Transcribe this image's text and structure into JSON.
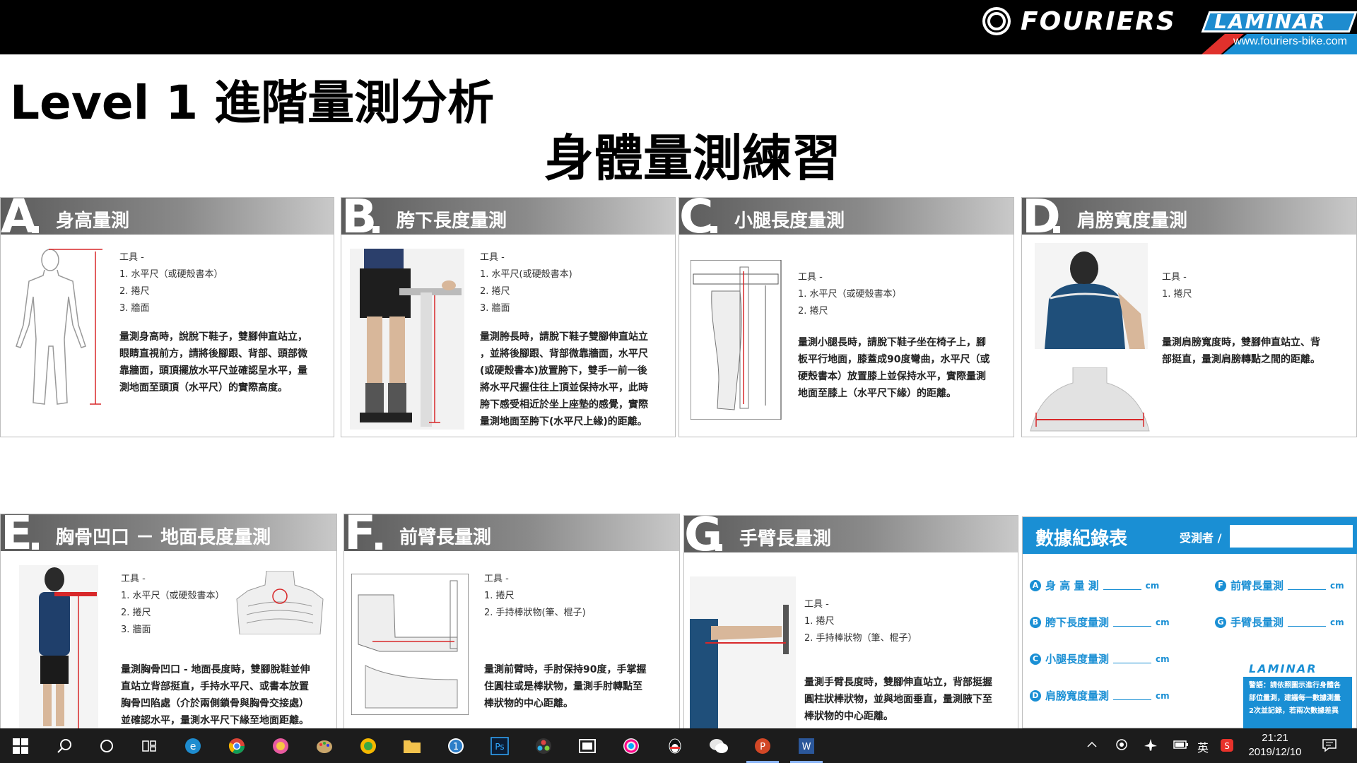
{
  "header": {
    "brand": "FOURIERS",
    "brand2": "LAMINAR",
    "website": "www.fouriers-bike.com"
  },
  "titles": {
    "level": "Level 1 進階量測分析",
    "main": "身體量測練習"
  },
  "cards": {
    "a": {
      "letter": "A",
      "title": "身高量測",
      "tools": [
        "工具 -",
        "1. 水平尺（或硬殼書本）",
        "2. 捲尺",
        "3. 牆面"
      ],
      "desc": [
        "量測身高時，說脫下鞋子，雙腳伸直站立，",
        "眼睛直視前方，請將後腳跟、背部、頭部微",
        "靠牆面，頭頂擺放水平尺並確認呈水平，量",
        "測地面至頭頂（水平尺）的實際高度。"
      ]
    },
    "b": {
      "letter": "B",
      "title": "胯下長度量測",
      "tools": [
        "工具 -",
        "1. 水平尺(或硬殼書本)",
        "2. 捲尺",
        "3. 牆面"
      ],
      "desc": [
        "量測胯長時，請脫下鞋子雙腳伸直站立",
        "，並將後腳跟、背部微靠牆面，水平尺",
        "(或硬殼書本)放置胯下，雙手一前一後",
        "將水平尺握住往上頂並保持水平，此時",
        "胯下感受相近於坐上座墊的感覺，實際",
        "量測地面至胯下(水平尺上緣)的距離。"
      ]
    },
    "c": {
      "letter": "C",
      "title": "小腿長度量測",
      "tools": [
        "工具 -",
        "1. 水平尺（或硬殼書本）",
        "2. 捲尺"
      ],
      "desc": [
        "量測小腿長時，請脫下鞋子坐在椅子上，腳",
        "板平行地面，膝蓋成90度彎曲，水平尺（或",
        "硬殼書本）放置膝上並保持水平，實際量測",
        "地面至膝上（水平尺下緣）的距離。"
      ]
    },
    "d": {
      "letter": "D",
      "title": "肩膀寬度量測",
      "tools": [
        "工具 -",
        "1. 捲尺"
      ],
      "desc": [
        "量測肩膀寬度時，雙腳伸直站立、背",
        "部挺直，量測肩膀轉點之間的距離。"
      ]
    },
    "e": {
      "letter": "E",
      "title": "胸骨凹口 － 地面長度量測",
      "tools": [
        "工具 -",
        "1. 水平尺（或硬殼書本）",
        "2. 捲尺",
        "3. 牆面"
      ],
      "desc": [
        "量測胸骨凹口 - 地面長度時，雙腳脫鞋並伸",
        "直站立背部挺直，手持水平尺、或書本放置",
        "胸骨凹陷處（介於兩側鎖骨與胸骨交接處）",
        "並確認水平，量測水平尺下緣至地面距離。"
      ]
    },
    "f": {
      "letter": "F",
      "title": "前臂長量測",
      "tools": [
        "工具 -",
        "1. 捲尺",
        "2. 手持棒狀物(筆、棍子)"
      ],
      "desc": [
        "量測前臂時，手肘保持90度，手掌握",
        "住圓柱或是棒狀物，量測手肘轉點至",
        "棒狀物的中心距離。"
      ]
    },
    "g": {
      "letter": "G",
      "title": "手臂長量測",
      "tools": [
        "工具 -",
        "1. 捲尺",
        "2. 手持棒狀物（筆、棍子）"
      ],
      "desc": [
        "量測手臂長度時，雙腳伸直站立，背部挺握",
        "圓柱狀棒狀物，並與地面垂直，量測腋下至",
        "棒狀物的中心距離。"
      ]
    }
  },
  "data_table": {
    "title": "數據紀錄表",
    "tester_label": "受測者 /",
    "unit": "cm",
    "rows_left": [
      {
        "badge": "A",
        "label": "身 高 量 測"
      },
      {
        "badge": "B",
        "label": "胯下長度量測"
      },
      {
        "badge": "C",
        "label": "小腿長度量測"
      },
      {
        "badge": "D",
        "label": "肩膀寬度量測"
      }
    ],
    "rows_right": [
      {
        "badge": "F",
        "label": "前臂長量測"
      },
      {
        "badge": "G",
        "label": "手臂長量測"
      }
    ],
    "brand": "LAMINAR",
    "warning": [
      "警語：請依照圖示進行身體各",
      "部位量測，建議每一數據測量",
      "2次並記錄，若兩次數據差異"
    ]
  },
  "taskbar": {
    "time": "21:21",
    "date": "2019/12/10",
    "ime": "英"
  },
  "colors": {
    "accent": "#1a8fd4",
    "measure_red": "#d8282a",
    "header_bg": "#000000",
    "card_head": "#7a7a7a"
  }
}
